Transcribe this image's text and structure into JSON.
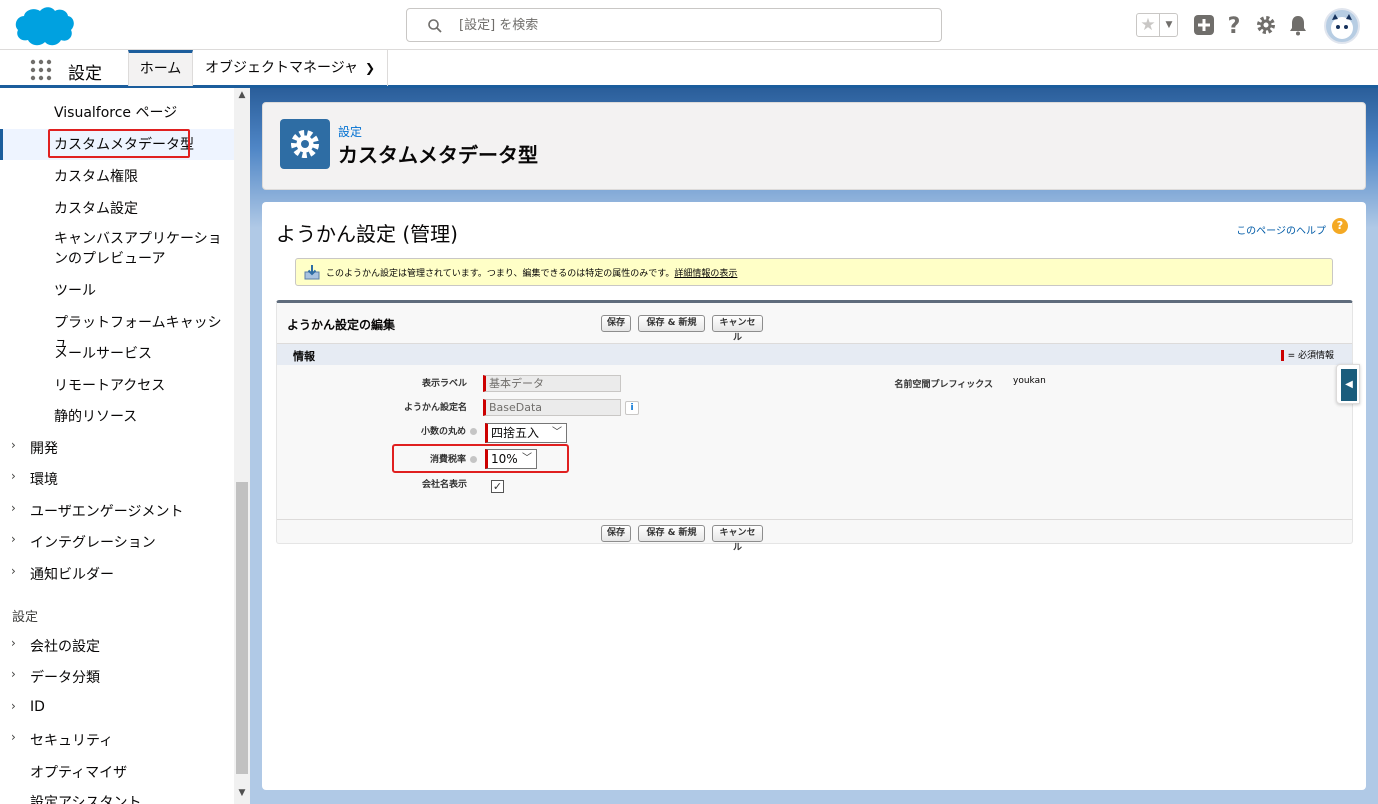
{
  "header": {
    "search_placeholder": "[設定] を検索"
  },
  "nav": {
    "app_title": "設定",
    "tabs": [
      {
        "label": "ホーム"
      },
      {
        "label": "オブジェクトマネージャ"
      }
    ]
  },
  "sidebar": {
    "sub_items": [
      {
        "label": "Visualforce ページ"
      },
      {
        "label": "カスタムメタデータ型"
      },
      {
        "label": "カスタム権限"
      },
      {
        "label": "カスタム設定"
      },
      {
        "label": "キャンバスアプリケーションのプレビューア"
      },
      {
        "label": "ツール"
      },
      {
        "label": "プラットフォームキャッシュ"
      },
      {
        "label": "メールサービス"
      },
      {
        "label": "リモートアクセス"
      },
      {
        "label": "静的リソース"
      }
    ],
    "groups_a": [
      {
        "label": "開発"
      },
      {
        "label": "環境"
      },
      {
        "label": "ユーザエンゲージメント"
      },
      {
        "label": "インテグレーション"
      },
      {
        "label": "通知ビルダー"
      }
    ],
    "section_label": "設定",
    "groups_b": [
      {
        "label": "会社の設定"
      },
      {
        "label": "データ分類"
      },
      {
        "label": "ID"
      },
      {
        "label": "セキュリティ"
      }
    ],
    "plain_items": [
      {
        "label": "オプティマイザ"
      },
      {
        "label": "設定アシスタント"
      }
    ]
  },
  "page_header": {
    "eyebrow": "設定",
    "title": "カスタムメタデータ型"
  },
  "content": {
    "title": "ようかん設定 (管理)",
    "help_link": "このページのヘルプ",
    "info_text": "このようかん設定は管理されています。つまり、編集できるのは特定の属性のみです。",
    "info_link": "詳細情報の表示",
    "panel_title": "ようかん設定の編集",
    "buttons": {
      "save": "保存",
      "save_new": "保存 & 新規",
      "cancel": "キャンセル"
    },
    "section_title": "情報",
    "required_legend": "= 必須情報",
    "fields": {
      "label_label": "表示ラベル",
      "label_value": "基本データ",
      "name_label": "ようかん設定名",
      "name_value": "BaseData",
      "rounding_label": "小数の丸め",
      "rounding_value": "四捨五入",
      "tax_label": "消費税率",
      "tax_value": "10%",
      "company_label": "会社名表示",
      "company_checked": true,
      "namespace_label": "名前空間プレフィックス",
      "namespace_value": "youkan"
    }
  },
  "colors": {
    "brand": "#00a1e0",
    "nav_accent": "#1b5d9c",
    "highlight": "#e02020"
  }
}
